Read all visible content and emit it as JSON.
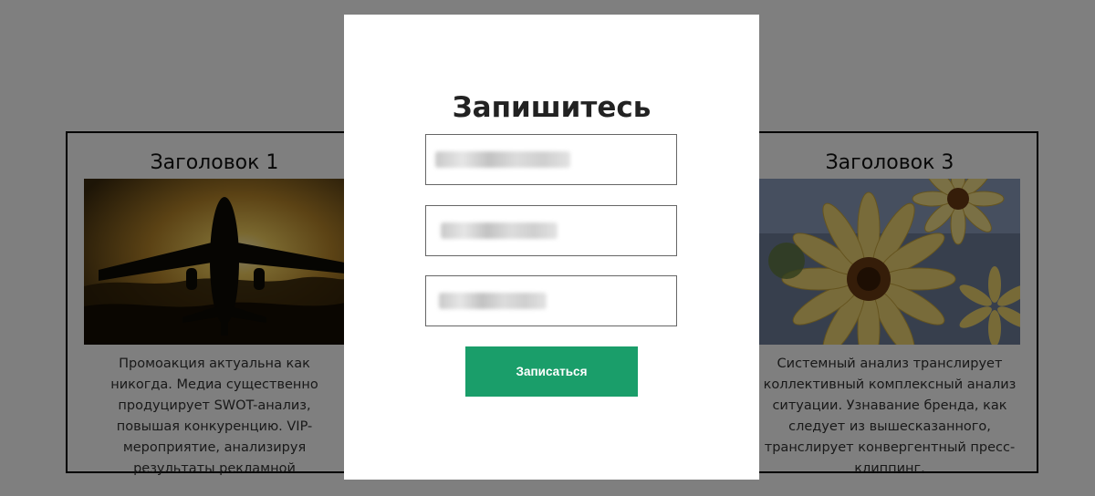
{
  "cards": [
    {
      "title": "Заголовок 1",
      "image": "airplane-sunset",
      "text": "Промоакция актуальна как никогда. Медиа существенно продуцирует SWOT-анализ, повышая конкуренцию. VIP-мероприятие, анализируя результаты рекламной"
    },
    {
      "title": "Заголовок 3",
      "image": "yellow-daisies",
      "text": "Системный анализ транслирует коллективный комплексный анализ ситуации. Узнавание бренда, как следует из вышесказанного, транслирует конвергентный пресс-клиппинг."
    }
  ],
  "modal": {
    "title": "Запишитесь",
    "submit_label": "Записаться"
  },
  "colors": {
    "overlay": "rgba(0,0,0,0.5)",
    "button": "#1a9e6a"
  }
}
